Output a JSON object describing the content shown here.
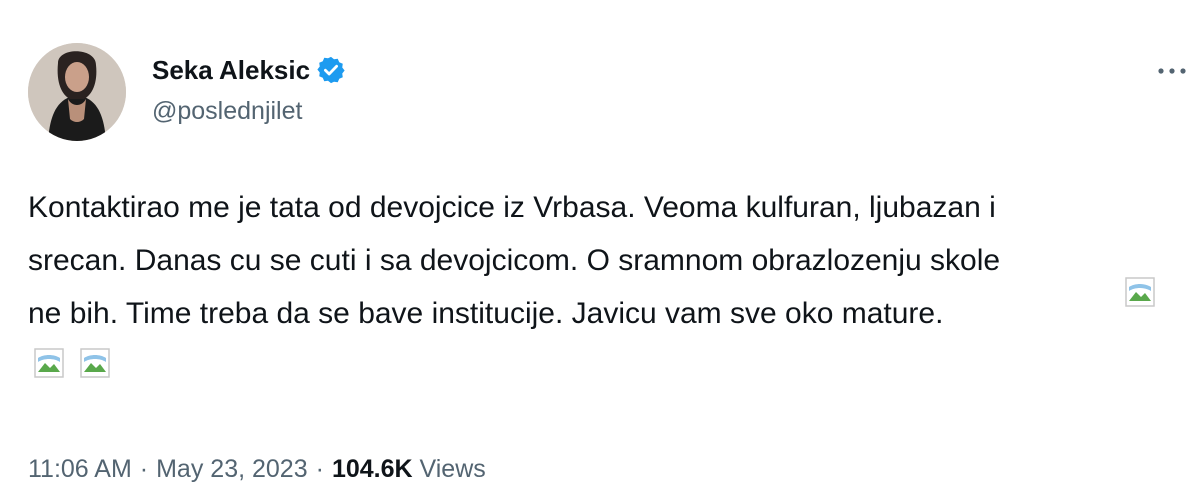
{
  "author": {
    "display_name": "Seka Aleksic",
    "handle": "@poslednjilet",
    "verified": true
  },
  "tweet": {
    "lines": [
      "Kontaktirao me je tata od devojcice iz Vrbasa. Veoma kulfuran, ljubazan i",
      "srecan. Danas cu se cuti i sa devojcicom. O sramnom obrazlozenju skole",
      "ne bih. Time treba da se bave institucije. Javicu vam sve oko mature."
    ],
    "emoji_count": 3
  },
  "meta": {
    "time": "11:06 AM",
    "separator": "·",
    "date": "May 23, 2023",
    "views_count": "104.6K",
    "views_label": "Views"
  },
  "icons": {
    "verified": "verified-badge-icon",
    "more": "more-dots-icon",
    "broken_image": "broken-image-icon"
  },
  "colors": {
    "text": "#0f1419",
    "secondary": "#536471",
    "verified": "#1d9bf0"
  }
}
